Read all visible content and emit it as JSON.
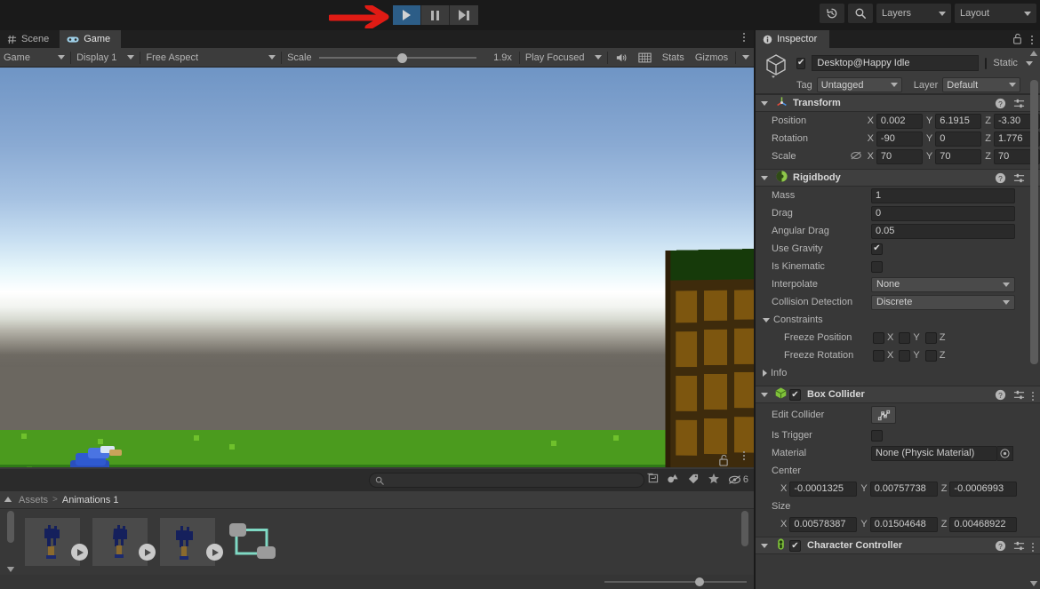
{
  "toolbar": {
    "play_label": "play-button",
    "pause_label": "pause-button",
    "step_label": "step-button",
    "history_icon": "undo-history-icon",
    "search_icon": "search-icon",
    "layers_label": "Layers",
    "layout_label": "Layout",
    "annotation": "red-arrow-pointing-at-play-button",
    "play_active_color": "#2c5d87"
  },
  "game_panel": {
    "tabs": [
      {
        "label": "Scene",
        "icon": "grid-icon",
        "active": false
      },
      {
        "label": "Game",
        "icon": "gamepad-icon",
        "active": true
      }
    ],
    "toolbar": {
      "display_mode": "Game",
      "display_target": "Display 1",
      "aspect": "Free Aspect",
      "scale_label": "Scale",
      "scale_value": "1.9x",
      "focus_mode": "Play Focused",
      "mute_icon": "speaker-icon",
      "mute_label": "mute-audio-button",
      "grid_icon": "grid-overlay-icon",
      "stats_label": "Stats",
      "gizmos_label": "Gizmos"
    },
    "scene": {
      "description": "pixel-art 3D game view: blue character on green grass, dirt strip with orange blocks, brown cliff wall on right, blue-to-white sky gradient",
      "sky_top_color": "#6f95c5",
      "sky_mid_color": "#ffffff",
      "fog_color": "#6b6760",
      "grass_light_color": "#4b9b1e",
      "grass_dark_color": "#2f7a17",
      "dirt_color": "#a9761b",
      "block_color": "#f0951e",
      "cliff_color": "#3e2b0c",
      "cliff_face_color": "#7d560f",
      "cliff_top_color": "#163a0a",
      "player_color": "#2a4fbe"
    }
  },
  "project_panel": {
    "search_placeholder": "",
    "search_value": "",
    "lock_icon": "lock-open-icon",
    "menu_icon": "kebab-menu-icon",
    "filter_icons": [
      {
        "name": "save-search-icon"
      },
      {
        "name": "filter-by-type-icon"
      },
      {
        "name": "filter-by-label-icon"
      },
      {
        "name": "favorites-star-icon"
      }
    ],
    "hidden_count": "6",
    "hidden_icon": "eye-off-icon",
    "breadcrumb": [
      "Assets",
      "Animations 1"
    ],
    "breadcrumb_sep": ">",
    "assets": [
      {
        "name": "animation-clip-1",
        "type": "animation-clip"
      },
      {
        "name": "animation-clip-2",
        "type": "animation-clip"
      },
      {
        "name": "animation-clip-3",
        "type": "animation-clip"
      },
      {
        "name": "animator-controller",
        "type": "animator-controller"
      }
    ],
    "zoom_value": ""
  },
  "inspector": {
    "tab_label": "Inspector",
    "tab_icon": "info-icon",
    "lock_icon": "lock-open-icon",
    "menu_icon": "kebab-menu-icon",
    "object": {
      "enabled": true,
      "name": "Desktop@Happy Idle",
      "static_label": "Static",
      "static_checked": false,
      "tag_label": "Tag",
      "tag_value": "Untagged",
      "layer_label": "Layer",
      "layer_value": "Default"
    },
    "components": [
      {
        "title": "Transform",
        "icon": "transform-axis-icon",
        "expanded": true,
        "has_checkbox": false,
        "rows": [
          {
            "label": "Position",
            "type": "vec3",
            "x": "0.002",
            "y": "6.1915",
            "z": "-3.30"
          },
          {
            "label": "Rotation",
            "type": "vec3",
            "x": "-90",
            "y": "0",
            "z": "1.776"
          },
          {
            "label": "Scale",
            "type": "vec3",
            "x": "70",
            "y": "70",
            "z": "70",
            "link_icon": "constrain-proportions-off-icon"
          }
        ]
      },
      {
        "title": "Rigidbody",
        "icon": "rigidbody-icon",
        "expanded": true,
        "has_checkbox": false,
        "rows": [
          {
            "label": "Mass",
            "type": "field",
            "value": "1"
          },
          {
            "label": "Drag",
            "type": "field",
            "value": "0"
          },
          {
            "label": "Angular Drag",
            "type": "field",
            "value": "0.05"
          },
          {
            "label": "Use Gravity",
            "type": "checkbox",
            "checked": true
          },
          {
            "label": "Is Kinematic",
            "type": "checkbox",
            "checked": false
          },
          {
            "label": "Interpolate",
            "type": "dropdown",
            "value": "None"
          },
          {
            "label": "Collision Detection",
            "type": "dropdown",
            "value": "Discrete"
          },
          {
            "label": "Constraints",
            "type": "foldout",
            "expanded": true
          },
          {
            "label": "Freeze Position",
            "type": "axis-toggles",
            "axes": [
              "X",
              "Y",
              "Z"
            ]
          },
          {
            "label": "Freeze Rotation",
            "type": "axis-toggles",
            "axes": [
              "X",
              "Y",
              "Z"
            ]
          },
          {
            "label": "Info",
            "type": "foldout",
            "expanded": false
          }
        ]
      },
      {
        "title": "Box Collider",
        "icon": "box-collider-icon",
        "expanded": true,
        "has_checkbox": true,
        "checked": true,
        "rows": [
          {
            "label": "Edit Collider",
            "type": "edit-button",
            "icon": "edit-collider-icon"
          },
          {
            "label": "Is Trigger",
            "type": "checkbox",
            "checked": false
          },
          {
            "label": "Material",
            "type": "object-field",
            "value": "None (Physic Material)",
            "picker_icon": "object-picker-icon"
          },
          {
            "label": "Center",
            "type": "vec3-label"
          },
          {
            "label": "",
            "type": "vec3",
            "x": "-0.0001325",
            "y": "0.00757738",
            "z": "-0.0006993"
          },
          {
            "label": "Size",
            "type": "vec3-label"
          },
          {
            "label": "",
            "type": "vec3",
            "x": "0.00578387",
            "y": "0.01504648",
            "z": "0.00468922"
          }
        ]
      },
      {
        "title": "Character Controller",
        "icon": "character-controller-icon",
        "expanded": true,
        "has_checkbox": true,
        "checked": true,
        "rows": []
      }
    ]
  }
}
